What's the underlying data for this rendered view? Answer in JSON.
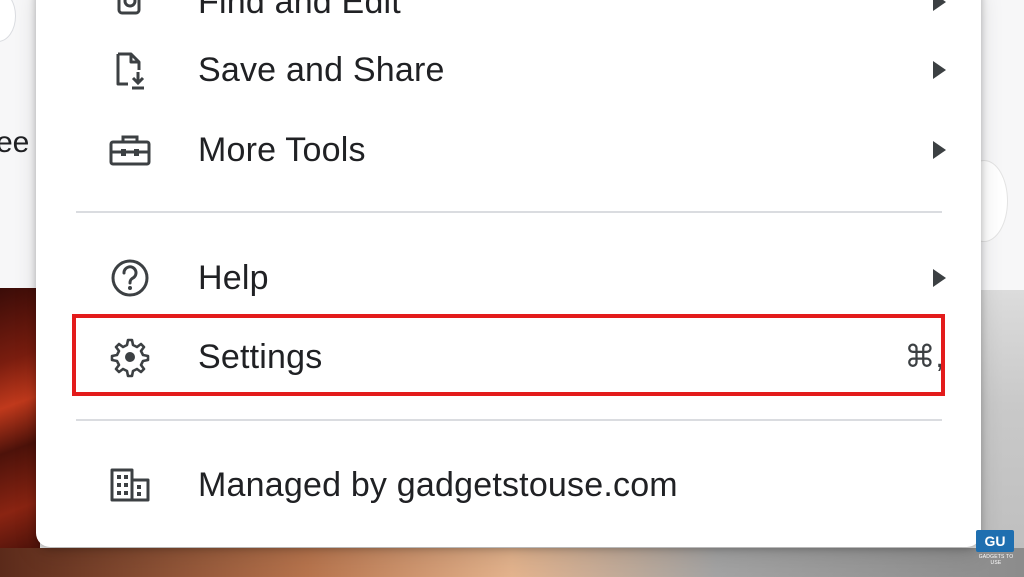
{
  "background": {
    "partial_text": "ee"
  },
  "menu": {
    "items": [
      {
        "label": "Find and Edit",
        "icon": "find-replace-icon",
        "has_submenu": true
      },
      {
        "label": "Save and Share",
        "icon": "file-download-icon",
        "has_submenu": true
      },
      {
        "label": "More Tools",
        "icon": "toolbox-icon",
        "has_submenu": true
      },
      {
        "label": "Help",
        "icon": "help-circle-icon",
        "has_submenu": true
      },
      {
        "label": "Settings",
        "icon": "gear-icon",
        "shortcut": "⌘,",
        "highlighted": true
      },
      {
        "label": "Managed by gadgetstouse.com",
        "icon": "building-icon"
      }
    ]
  },
  "highlight_color": "#e31b1b",
  "watermark": {
    "logo": "GU",
    "text": "GADGETS TO USE"
  }
}
